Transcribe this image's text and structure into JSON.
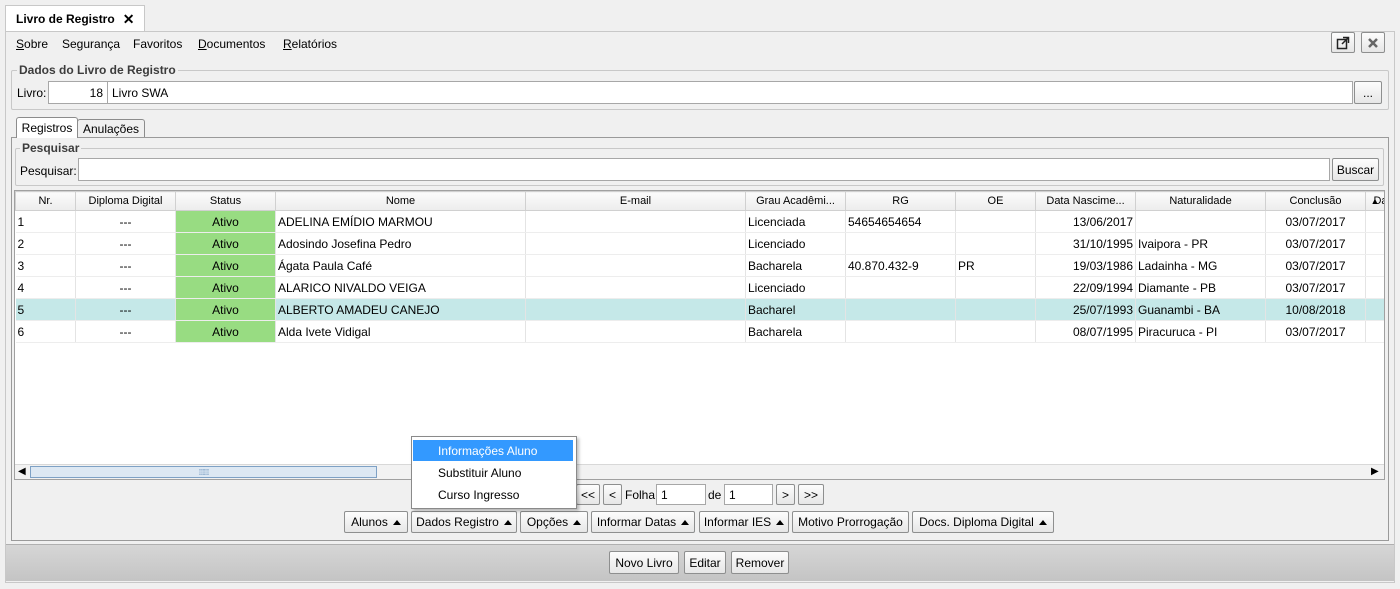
{
  "window": {
    "tab_title": "Livro de Registro"
  },
  "menubar": {
    "items": [
      {
        "label": "Sobre",
        "mnemonic": "S",
        "rest": "obre"
      },
      {
        "label": "Segurança"
      },
      {
        "label": "Favoritos"
      },
      {
        "label": "Documentos",
        "mnemonic": "D",
        "rest": "ocumentos"
      },
      {
        "label": "Relatórios",
        "mnemonic": "R",
        "rest": "elatórios"
      }
    ]
  },
  "book": {
    "legend": "Dados do Livro de Registro",
    "label": "Livro:",
    "number": "18",
    "name": "Livro SWA",
    "browse": "..."
  },
  "tabs": [
    {
      "label": "Registros"
    },
    {
      "label": "Anulações"
    }
  ],
  "search": {
    "legend": "Pesquisar",
    "label": "Pesquisar:",
    "value": "",
    "button": "Buscar"
  },
  "table": {
    "columns": [
      "Nr.",
      "Diploma Digital",
      "Status",
      "Nome",
      "E-mail",
      "Grau Acadêmi...",
      "RG",
      "OE",
      "Data Nascime...",
      "Naturalidade",
      "Conclusão",
      "Da"
    ],
    "rows": [
      [
        "1",
        "---",
        "Ativo",
        "ADELINA EMÍDIO MARMOU",
        "",
        "Licenciada",
        "54654654654",
        "",
        "13/06/2017",
        "",
        "03/07/2017",
        ""
      ],
      [
        "2",
        "---",
        "Ativo",
        "Adosindo Josefina Pedro",
        "",
        "Licenciado",
        "",
        "",
        "31/10/1995",
        "Ivaipora - PR",
        "03/07/2017",
        ""
      ],
      [
        "3",
        "---",
        "Ativo",
        "Ágata Paula Café",
        "",
        "Bacharela",
        "40.870.432-9",
        "PR",
        "19/03/1986",
        "Ladainha - MG",
        "03/07/2017",
        ""
      ],
      [
        "4",
        "---",
        "Ativo",
        "ALARICO NIVALDO VEIGA",
        "",
        "Licenciado",
        "",
        "",
        "22/09/1994",
        "Diamante - PB",
        "03/07/2017",
        ""
      ],
      [
        "5",
        "---",
        "Ativo",
        "ALBERTO AMADEU CANEJO",
        "",
        "Bacharel",
        "",
        "",
        "25/07/1993",
        "Guanambi - BA",
        "10/08/2018",
        ""
      ],
      [
        "6",
        "---",
        "Ativo",
        "Alda Ivete Vidigal",
        "",
        "Bacharela",
        "",
        "",
        "08/07/1995",
        "Piracuruca - PI",
        "03/07/2017",
        ""
      ]
    ],
    "selected_row": 4
  },
  "pagination": {
    "first": "<<",
    "prev": "<",
    "folha_label": "Folha",
    "folha_value": "1",
    "de_label": "de",
    "total_value": "1",
    "next": ">",
    "last": ">>"
  },
  "popup": {
    "items": [
      "Informações Aluno",
      "Substituir Aluno",
      "Curso Ingresso"
    ],
    "highlighted": 0
  },
  "action_buttons": [
    "Alunos",
    "Dados Registro",
    "Opções",
    "Informar Datas",
    "Informar IES",
    "Motivo Prorrogação",
    "Docs. Diploma Digital"
  ],
  "bottom_buttons": [
    "Novo Livro",
    "Editar",
    "Remover"
  ],
  "colors": {
    "status_green": "#98dc82",
    "selected_row": "#c5e8e8",
    "popup_highlight": "#3399ff"
  }
}
